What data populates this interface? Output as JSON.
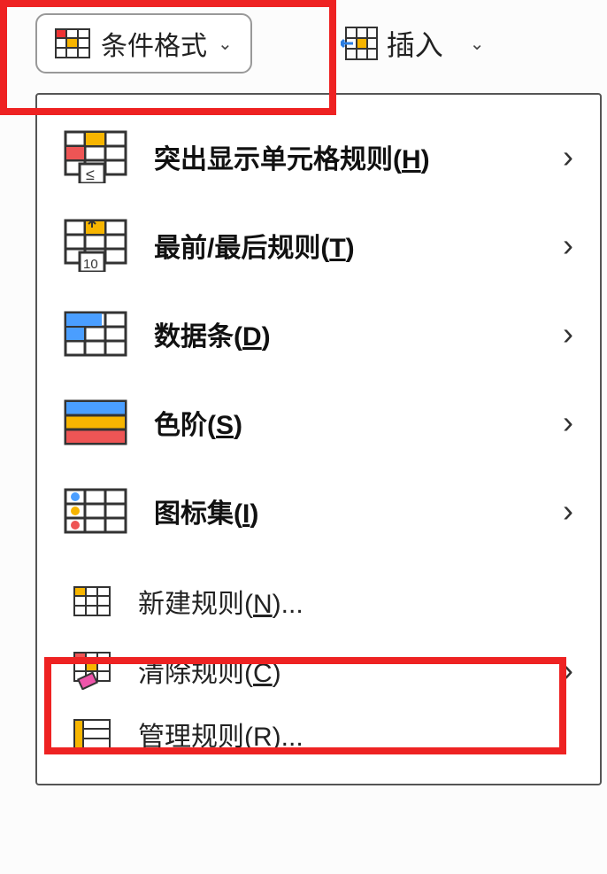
{
  "toolbar": {
    "conditional_format": "条件格式",
    "insert": "插入"
  },
  "menu": {
    "highlight_cells": "突出显示单元格规则(",
    "highlight_cells_key": "H",
    "highlight_cells_suffix": ")",
    "top_bottom": "最前/最后规则(",
    "top_bottom_key": "T",
    "top_bottom_suffix": ")",
    "data_bars": "数据条(",
    "data_bars_key": "D",
    "data_bars_suffix": ")",
    "color_scales": "色阶(",
    "color_scales_key": "S",
    "color_scales_suffix": ")",
    "icon_sets": "图标集(",
    "icon_sets_key": "I",
    "icon_sets_suffix": ")",
    "new_rule": "新建规则(",
    "new_rule_key": "N",
    "new_rule_suffix": ")...",
    "clear_rules": "清除规则(",
    "clear_rules_key": "C",
    "clear_rules_suffix": ")",
    "manage_rules": "管理规则(",
    "manage_rules_key": "R",
    "manage_rules_suffix": ")..."
  }
}
